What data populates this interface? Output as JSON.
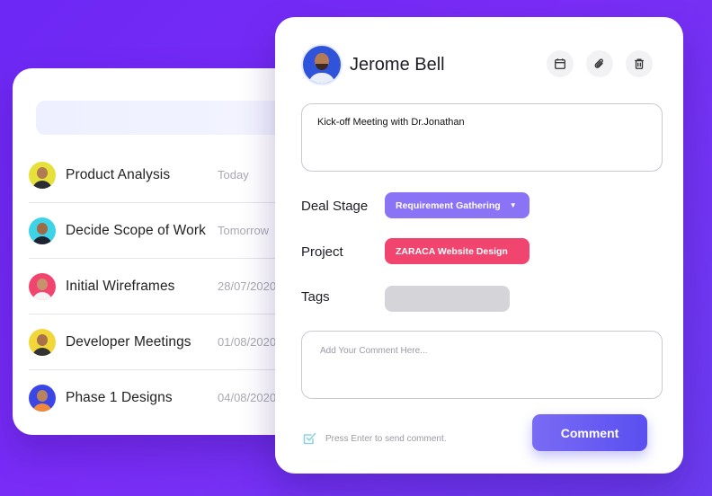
{
  "tasks": [
    {
      "title": "Product Analysis",
      "date": "Today",
      "avatar_color": "#e6e03a"
    },
    {
      "title": "Decide Scope of Work",
      "date": "Tomorrow",
      "avatar_color": "#3fd3e8"
    },
    {
      "title": "Initial Wireframes",
      "date": "28/07/2020",
      "avatar_color": "#f1456f"
    },
    {
      "title": "Developer Meetings",
      "date": "01/08/2020",
      "avatar_color": "#f2d73a"
    },
    {
      "title": "Phase 1 Designs",
      "date": "04/08/2020",
      "avatar_color": "#3b46e6"
    }
  ],
  "detail": {
    "user_name": "Jerome Bell",
    "meeting_text": "Kick-off Meeting with Dr.Jonathan",
    "deal_stage_label": "Deal Stage",
    "deal_stage_value": "Requirement Gathering",
    "project_label": "Project",
    "project_value": "ZARACA Website Design",
    "tags_label": "Tags",
    "comment_placeholder": "Add Your Comment Here...",
    "hint_text": "Press Enter to send comment.",
    "comment_button": "Comment"
  },
  "icons": [
    "calendar-icon",
    "paperclip-icon",
    "trash-icon",
    "checkbox-icon",
    "caret-down-icon"
  ],
  "colors": {
    "background": "#6d28f5",
    "accent": "#8b73f5",
    "project_pill": "#f1456f",
    "button": "#5a4ff0"
  }
}
